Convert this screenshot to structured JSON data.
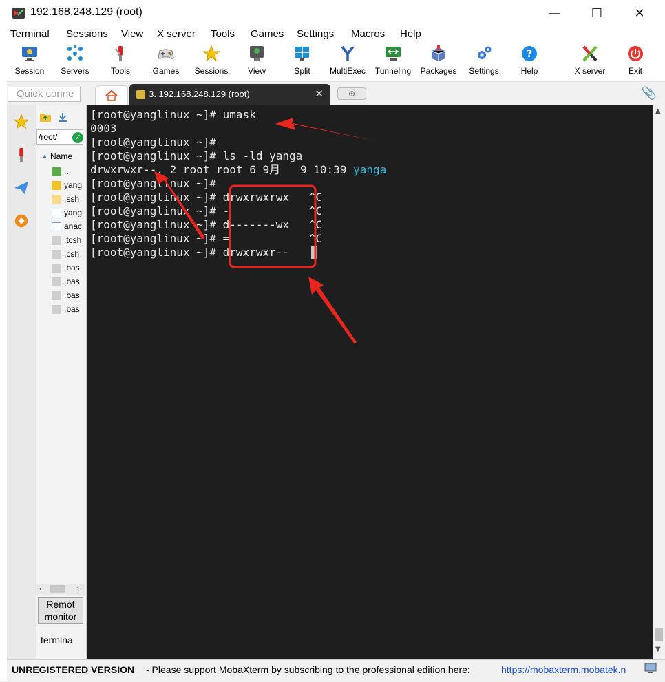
{
  "window": {
    "title": "192.168.248.129 (root)"
  },
  "menubar": [
    "Terminal",
    "Sessions",
    "View",
    "X server",
    "Tools",
    "Games",
    "Settings",
    "Macros",
    "Help"
  ],
  "toolbar": [
    {
      "label": "Session",
      "icon": "session-icon"
    },
    {
      "label": "Servers",
      "icon": "servers-icon"
    },
    {
      "label": "Tools",
      "icon": "tools-icon"
    },
    {
      "label": "Games",
      "icon": "gamepad-icon"
    },
    {
      "label": "Sessions",
      "icon": "star-icon"
    },
    {
      "label": "View",
      "icon": "view-icon"
    },
    {
      "label": "Split",
      "icon": "split-icon"
    },
    {
      "label": "MultiExec",
      "icon": "multiexec-icon"
    },
    {
      "label": "Tunneling",
      "icon": "tunneling-icon"
    },
    {
      "label": "Packages",
      "icon": "packages-icon"
    },
    {
      "label": "Settings",
      "icon": "gears-icon"
    },
    {
      "label": "Help",
      "icon": "help-icon"
    },
    {
      "label": "X server",
      "icon": "x-server-icon"
    },
    {
      "label": "Exit",
      "icon": "power-icon"
    }
  ],
  "tabs": {
    "quick_connect_placeholder": "Quick conne",
    "session_tab_label": "3. 192.168.248.129 (root)"
  },
  "file_browser": {
    "path": "/root/",
    "column_header": "Name",
    "items": [
      "..",
      "yang",
      ".ssh",
      "yang",
      "anac",
      ".tcsh",
      ".csh",
      ".bas",
      ".bas",
      ".bas",
      ".bas"
    ],
    "remote_button": [
      "Remot",
      "monitor"
    ],
    "terminal_label": "termina"
  },
  "terminal": {
    "lines": [
      {
        "prompt": "[root@yanglinux ~]# ",
        "text": "umask"
      },
      {
        "prompt": "",
        "text": "0003"
      },
      {
        "prompt": "[root@yanglinux ~]# ",
        "text": ""
      },
      {
        "prompt": "[root@yanglinux ~]# ",
        "text": "ls -ld yanga"
      },
      {
        "prompt": "",
        "text": "drwxrwxr--. 2 root root 6 9月   9 10:39 ",
        "highlight": "yanga"
      },
      {
        "prompt": "[root@yanglinux ~]# ",
        "text": ""
      },
      {
        "prompt": "[root@yanglinux ~]# ",
        "text": "drwxrwxrwx   ^C"
      },
      {
        "prompt": "[root@yanglinux ~]# ",
        "text": "-            ^C"
      },
      {
        "prompt": "[root@yanglinux ~]# ",
        "text": "d-------wx   ^C"
      },
      {
        "prompt": "[root@yanglinux ~]# ",
        "text": "=            ^C"
      },
      {
        "prompt": "[root@yanglinux ~]# ",
        "text": "drwxrwxr-- "
      }
    ]
  },
  "annotation_color": "#e8261e",
  "statusbar": {
    "unregistered": "UNREGISTERED VERSION",
    "message": "  -  Please support MobaXterm by subscribing to the professional edition here:  ",
    "link": "https://mobaxterm.mobatek.n"
  }
}
